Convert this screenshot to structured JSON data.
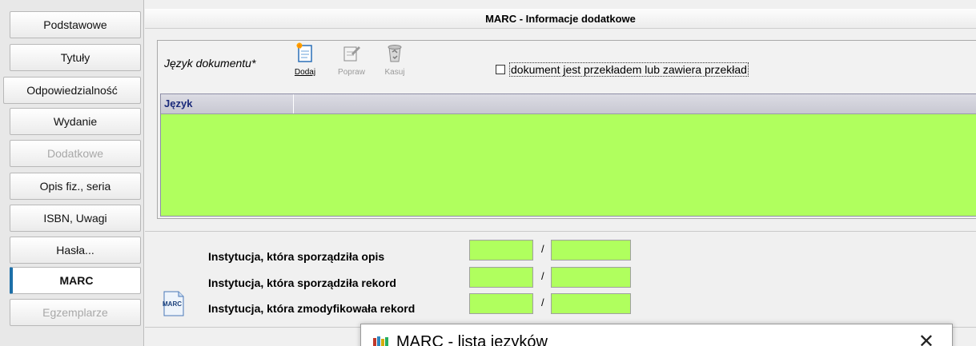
{
  "nav": {
    "items": [
      {
        "label": "Podstawowe",
        "state": "normal"
      },
      {
        "label": "Tytuły",
        "state": "normal"
      },
      {
        "label": "Odpowiedzialność",
        "state": "normal"
      },
      {
        "label": "Wydanie",
        "state": "normal"
      },
      {
        "label": "Dodatkowe",
        "state": "disabled"
      },
      {
        "label": "Opis fiz., seria",
        "state": "normal"
      },
      {
        "label": "ISBN, Uwagi",
        "state": "normal"
      },
      {
        "label": "Hasła...",
        "state": "normal"
      },
      {
        "label": "MARC",
        "state": "active"
      },
      {
        "label": "Egzemplarze",
        "state": "disabled"
      }
    ]
  },
  "header": {
    "title": "MARC - Informacje dodatkowe"
  },
  "language": {
    "label": "Język dokumentu*",
    "tools": {
      "add": "Dodaj",
      "edit": "Popraw",
      "delete": "Kasuj"
    },
    "translation_checkbox": {
      "label": "dokument jest przekładem lub zawiera przekład",
      "checked": false
    },
    "table": {
      "columns": [
        "Język",
        ""
      ],
      "rows": []
    }
  },
  "institutions": {
    "rows": [
      {
        "label": "Instytucja, która sporządziła opis",
        "code": "",
        "subcode": ""
      },
      {
        "label": "Instytucja, która sporządziła rekord",
        "code": "",
        "subcode": ""
      },
      {
        "label": "Instytucja, która zmodyfikowała rekord",
        "code": "",
        "subcode": ""
      }
    ],
    "separator": "/",
    "icon_text": "MARC"
  },
  "dialog": {
    "title": "MARC - lista języków",
    "close": "✕"
  },
  "colors": {
    "field_green": "#b0ff5e",
    "active_accent": "#1d6fa8",
    "grid_header_text": "#1b2a7a"
  }
}
